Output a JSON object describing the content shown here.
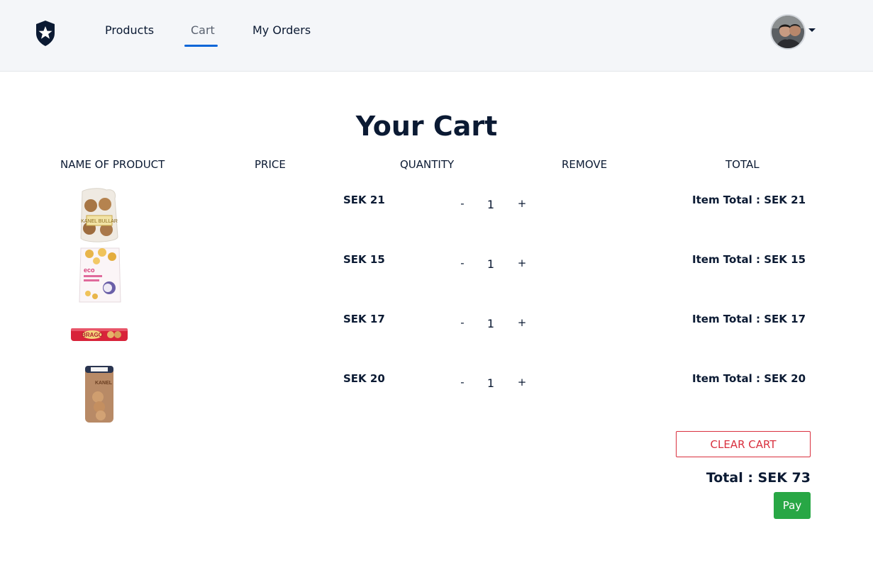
{
  "nav": {
    "links": [
      {
        "label": "Products"
      },
      {
        "label": "Cart"
      },
      {
        "label": "My Orders"
      }
    ]
  },
  "page": {
    "title": "Your Cart",
    "columns": [
      "NAME OF PRODUCT",
      "PRICE",
      "QUANTITY",
      "REMOVE",
      "TOTAL"
    ]
  },
  "cart": {
    "items": [
      {
        "image_label": "KANEL BULLAR",
        "price": "SEK 21",
        "minus": "-",
        "quantity": "1",
        "plus": "+",
        "item_total": "Item Total : SEK 21"
      },
      {
        "image_label": "eco",
        "price": "SEK 15",
        "minus": "-",
        "quantity": "1",
        "plus": "+",
        "item_total": "Item Total : SEK 15"
      },
      {
        "image_label": "BRAGO",
        "price": "SEK 17",
        "minus": "-",
        "quantity": "1",
        "plus": "+",
        "item_total": "Item Total : SEK 17"
      },
      {
        "image_label": "KANEL",
        "price": "SEK 20",
        "minus": "-",
        "quantity": "1",
        "plus": "+",
        "item_total": "Item Total : SEK 20"
      }
    ],
    "clear_label": "CLEAR CART",
    "total": "Total : SEK 73",
    "pay_label": "Pay"
  },
  "colors": {
    "accent": "#0a66d8",
    "danger": "#d9303e",
    "success": "#28a745",
    "navbar_bg": "#f4f6f9"
  }
}
